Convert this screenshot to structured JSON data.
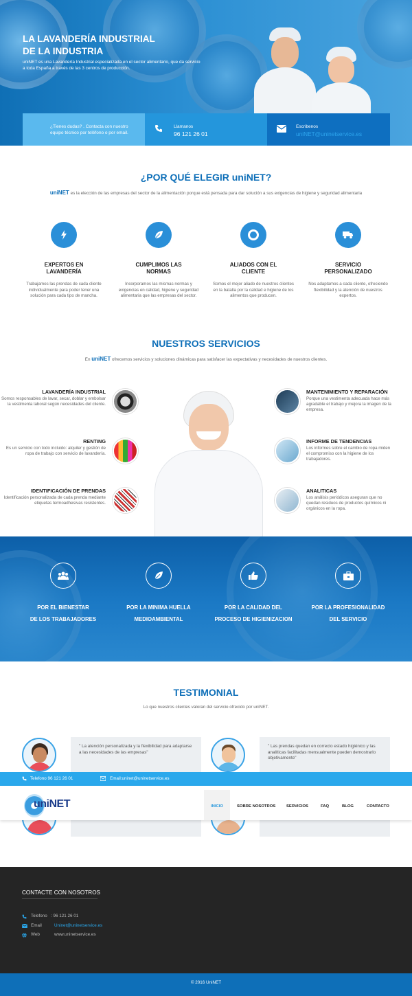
{
  "hero": {
    "title_line1": "LA LAVANDERÍA INDUSTRIAL",
    "title_line2": "DE LA INDUSTRIA",
    "text": "uniNET es una Lavandería Industrial especializada en el sector alimentario, que da servicio a toda España a través de las 3 centros de producción."
  },
  "contact_bar": {
    "question": "¿Tienes dudas? . Contacta con nuestro equipo técnico por teléfono o por email.",
    "call_label": "Llamanos",
    "phone": "96 121 26 01",
    "write_label": "Escribenos",
    "email": "uniNET@uninetservice.es",
    "colors": {
      "light": "#5ab9ee",
      "mid": "#2496dc",
      "dark": "#0e6fc0"
    }
  },
  "why": {
    "title": "¿POR QUÉ ELEGIR uniNET?",
    "brand": "uniNET",
    "subtitle": "es la elección de las empresas del sector de la alimentación porque está pensada para dar solución a sus exigencias de higiene y seguridad alimentaria",
    "items": [
      {
        "icon": "lightning-icon",
        "title_1": "EXPERTOS EN",
        "title_2": "LAVANDERÍA",
        "text": "Trabajamos las prendas de cada cliente individualmente para poder tener una solución para cada tipo de mancha."
      },
      {
        "icon": "leaf-icon",
        "title_1": "CUMPLIMOS LAS",
        "title_2": "NORMAS",
        "text": "Incorporamos las mismas normas y exigencias en calidad, higiene y seguridad alimentaria que las empresas del sector."
      },
      {
        "icon": "lifebuoy-icon",
        "title_1": "ALIADOS CON EL",
        "title_2": "CLIENTE",
        "text": "Somos el mejor aliado de nuestros clientes en la batalla por la calidad e higiene de los alimentos que producen."
      },
      {
        "icon": "truck-icon",
        "title_1": "SERVICIO",
        "title_2": "PERSONALIZADO",
        "text": "Nos adaptamos a cada cliente, ofreciendo flexibilidad y la atención de nuestros expertos."
      }
    ]
  },
  "services": {
    "title": "NUESTROS SERVICIOS",
    "pre": "En",
    "brand": "uniNET",
    "subtitle": "ofrecemos servicios y soluciones dinámicas para satisfacer las expectativas y necesidades de nuestros clientes.",
    "left": [
      {
        "title": "LAVANDERÍA INDUSTRIAL",
        "text": "Somos responsables de lavar, secar, doblar y embolsar la vestimenta laboral según necesidades del cliente."
      },
      {
        "title": "RENTING",
        "text": "Es un servicio con todo incluido: alquiler y gestión de ropa de trabajo con servicio de lavandería."
      },
      {
        "title": "IDENTIFICACIÓN DE PRENDAS",
        "text": "Identificación personalizada de cada prenda mediante etiquetas termoadhesivas resistentes."
      }
    ],
    "right": [
      {
        "title": "MANTENIMIENTO Y REPARACIÓN",
        "text": "Porque una vestimenta adecuada hace más agradable el trabajo y mejora la imagen de la empresa."
      },
      {
        "title": "INFORME DE TENDENCIAS",
        "text": "Los informes sobre el cambio de ropa miden el compromiso con la higiene de los trabajadores."
      },
      {
        "title": "ANALITICAS",
        "text": "Los análisis periódicos aseguran que no quedan residuos de productos químicos ni orgánicos en la ropa."
      }
    ]
  },
  "features": [
    {
      "icon": "group-icon",
      "line1": "POR EL BIENESTAR",
      "line2": "DE LOS TRABAJADORES"
    },
    {
      "icon": "leaf-icon",
      "line1": "POR LA MINIMA HUELLA",
      "line2": "MEDIOAMBIENTAL"
    },
    {
      "icon": "thumbs-up-icon",
      "line1": "POR LA CALIDAD DEL",
      "line2": "PROCESO DE HIGIENIZACION"
    },
    {
      "icon": "briefcase-icon",
      "line1": "POR LA PROFESIONALIDAD",
      "line2": "DEL SERVICIO"
    }
  ],
  "testimonial": {
    "title": "TESTIMONIAL",
    "subtitle": "Lo que nuestros clientes valoran del servicio ofrecido por uniNET.",
    "quotes": [
      "\" La atención personalizada y la flexibilidad para adaptarse a las necesidades de las empresas\"",
      "\" Las prendas quedan en correcto estado higiénico y las analíticas facilitadas mensualmente pueden demostrarlo objetivamente\""
    ]
  },
  "topbar": {
    "phone": "Telefono 96 121 26 01",
    "email": "Email:uninet@uninetservice.es"
  },
  "nav": {
    "logo": "uniNET",
    "items": [
      "INICIO",
      "SOBRE NOSOTROS",
      "SERVICIOS",
      "FAQ",
      "BLOG",
      "CONTACTO"
    ]
  },
  "footer": {
    "title": "CONTACTE CON NOSOTROS",
    "phone_label": "Telefono",
    "phone": ": 96 121 26 01",
    "email_label": "Email",
    "email": "Uninet@uninetservice.es",
    "web_label": "Web",
    "web": "www.uninetservice.es",
    "copyright": "© 2016 UniNET"
  }
}
